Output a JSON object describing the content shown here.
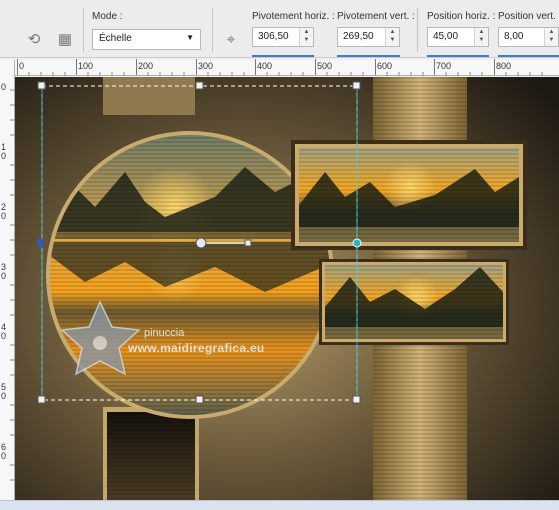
{
  "toolbar": {
    "mode_label": "Mode :",
    "mode_value": "Échelle",
    "pivot_h_label": "Pivotement horiz. :",
    "pivot_h_value": "306,50",
    "pivot_v_label": "Pivotement vert. :",
    "pivot_v_value": "269,50",
    "pos_h_label": "Position horiz. :",
    "pos_h_value": "45,00",
    "pos_v_label": "Position vert. :",
    "pos_v_value": "8,00"
  },
  "ruler": {
    "top_labels": [
      "0",
      "100",
      "200",
      "300",
      "400",
      "500",
      "600",
      "700",
      "800"
    ],
    "left_labels": [
      "0",
      "1",
      "0",
      "2",
      "0",
      "3",
      "0",
      "4",
      "0",
      "5",
      "0",
      "6",
      "0"
    ]
  },
  "watermark": {
    "name": "pinuccia",
    "site": "www.maidiregrafica.eu"
  },
  "colors": {
    "toolbar_bg": "#ececec",
    "canvas_dark": "#2a2418",
    "gold": "#b6924f",
    "sunset": "#f5a21c",
    "selection_accent": "#3a7fd5"
  },
  "icons": {
    "perspective": "perspective-icon",
    "mesh": "mesh-icon",
    "pivot": "pivot-icon",
    "spin_arrows": "spin-arrows-icon",
    "dropdown": "chevron-down-icon"
  }
}
